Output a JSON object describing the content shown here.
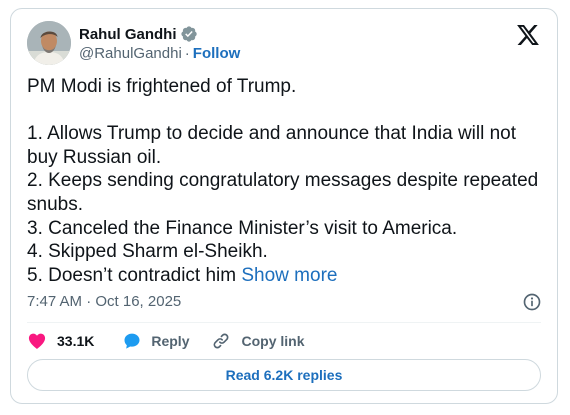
{
  "author": {
    "display_name": "Rahul Gandhi",
    "handle": "@RahulGandhi",
    "separator": "·",
    "follow_label": "Follow",
    "verified": true
  },
  "tweet": {
    "lines": [
      "PM Modi is frightened of Trump.",
      "",
      "1. Allows Trump to decide and announce that India will not",
      "buy Russian oil.",
      "2. Keeps sending congratulatory messages despite repeated",
      "snubs.",
      "3. Canceled the Finance Minister’s visit to America.",
      "4. Skipped Sharm el-Sheikh.",
      "5. Doesn’t contradict him"
    ],
    "show_more_label": "Show more",
    "timestamp": "7:47 AM · Oct 16, 2025"
  },
  "actions": {
    "likes": "33.1K",
    "reply": "Reply",
    "copy_link": "Copy link"
  },
  "replies_button": "Read 6.2K replies",
  "colors": {
    "link_blue": "#1d6fbd",
    "like_red": "#f91880",
    "reply_blue": "#1d9bf0",
    "muted_text": "#536471",
    "border": "#cfd9de"
  },
  "icons": {
    "verified": "verified-badge-icon",
    "platform": "x-logo-icon",
    "info": "info-icon",
    "like": "heart-icon",
    "reply": "speech-bubble-icon",
    "copy_link": "link-icon"
  }
}
